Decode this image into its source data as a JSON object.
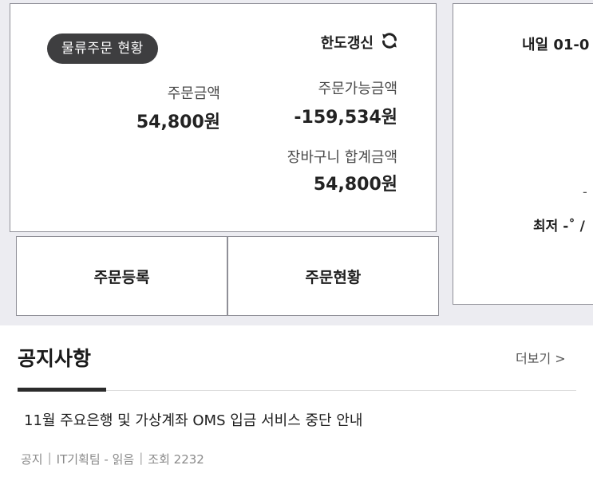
{
  "status_card": {
    "badge": "물류주문 현황",
    "refresh_label": "한도갱신",
    "order_amount_label": "주문금액",
    "order_amount_value": "54,800원",
    "available_amount_label": "주문가능금액",
    "available_amount_value": "-159,534원",
    "cart_total_label": "장바구니 합계금액",
    "cart_total_value": "54,800원"
  },
  "actions": {
    "register_label": "주문등록",
    "status_label": "주문현황"
  },
  "weather": {
    "date_label": "내일 01-0",
    "dash": "-",
    "minmax": "최저 -˚ /"
  },
  "notice": {
    "title": "공지사항",
    "more": "더보기 >",
    "items": [
      {
        "title": "11월 주요은행 및 가상계좌 OMS 입금 서비스 중단 안내",
        "category": "공지",
        "author": "IT기획팀 - 읽음",
        "views": "조회 2232"
      }
    ]
  },
  "colors": {
    "page_bg": "#ececf1",
    "badge_bg": "#3e3e40",
    "card_border": "#8f8f97"
  },
  "icons": {
    "refresh": "refresh-icon"
  }
}
